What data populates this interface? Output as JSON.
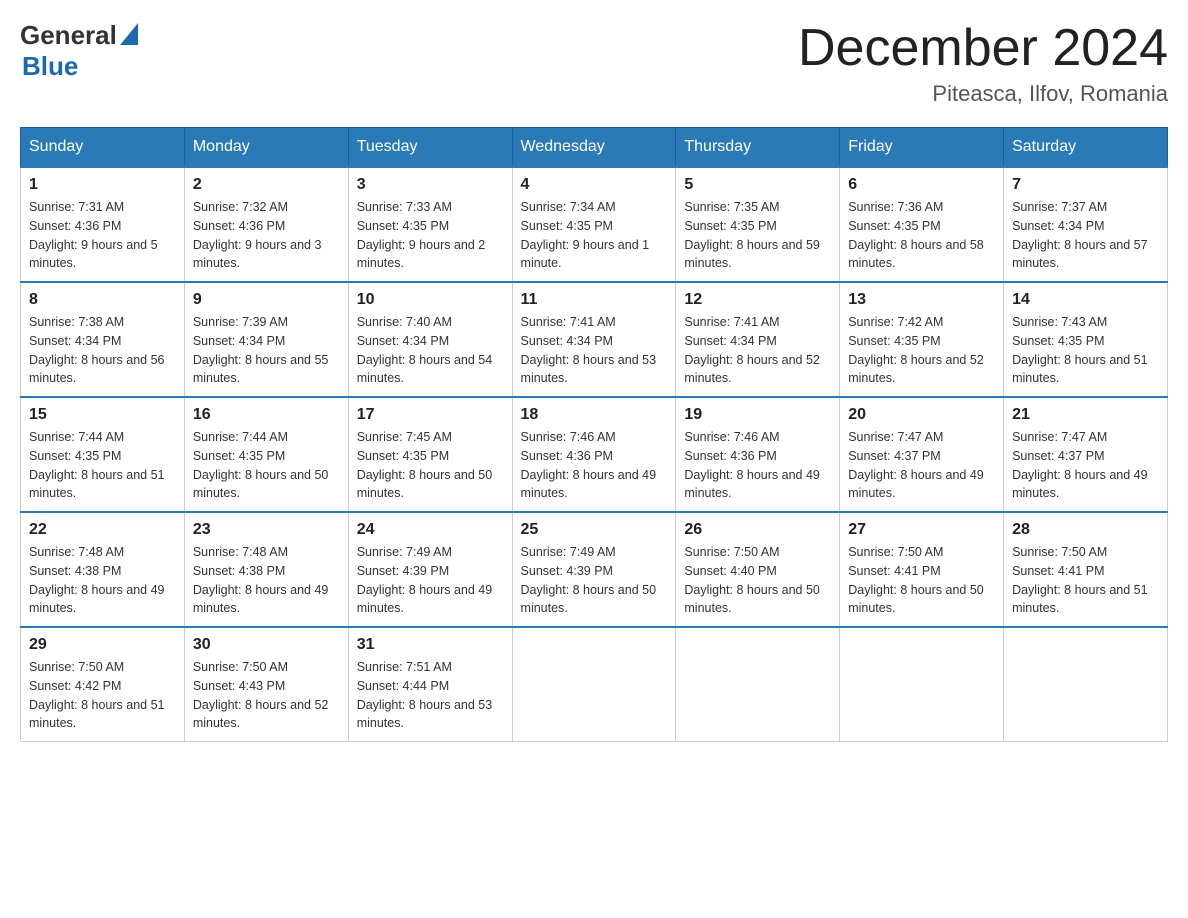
{
  "header": {
    "logo_general": "General",
    "logo_blue": "Blue",
    "title": "December 2024",
    "subtitle": "Piteasca, Ilfov, Romania"
  },
  "days_of_week": [
    "Sunday",
    "Monday",
    "Tuesday",
    "Wednesday",
    "Thursday",
    "Friday",
    "Saturday"
  ],
  "weeks": [
    [
      {
        "day": "1",
        "sunrise": "7:31 AM",
        "sunset": "4:36 PM",
        "daylight": "9 hours and 5 minutes."
      },
      {
        "day": "2",
        "sunrise": "7:32 AM",
        "sunset": "4:36 PM",
        "daylight": "9 hours and 3 minutes."
      },
      {
        "day": "3",
        "sunrise": "7:33 AM",
        "sunset": "4:35 PM",
        "daylight": "9 hours and 2 minutes."
      },
      {
        "day": "4",
        "sunrise": "7:34 AM",
        "sunset": "4:35 PM",
        "daylight": "9 hours and 1 minute."
      },
      {
        "day": "5",
        "sunrise": "7:35 AM",
        "sunset": "4:35 PM",
        "daylight": "8 hours and 59 minutes."
      },
      {
        "day": "6",
        "sunrise": "7:36 AM",
        "sunset": "4:35 PM",
        "daylight": "8 hours and 58 minutes."
      },
      {
        "day": "7",
        "sunrise": "7:37 AM",
        "sunset": "4:34 PM",
        "daylight": "8 hours and 57 minutes."
      }
    ],
    [
      {
        "day": "8",
        "sunrise": "7:38 AM",
        "sunset": "4:34 PM",
        "daylight": "8 hours and 56 minutes."
      },
      {
        "day": "9",
        "sunrise": "7:39 AM",
        "sunset": "4:34 PM",
        "daylight": "8 hours and 55 minutes."
      },
      {
        "day": "10",
        "sunrise": "7:40 AM",
        "sunset": "4:34 PM",
        "daylight": "8 hours and 54 minutes."
      },
      {
        "day": "11",
        "sunrise": "7:41 AM",
        "sunset": "4:34 PM",
        "daylight": "8 hours and 53 minutes."
      },
      {
        "day": "12",
        "sunrise": "7:41 AM",
        "sunset": "4:34 PM",
        "daylight": "8 hours and 52 minutes."
      },
      {
        "day": "13",
        "sunrise": "7:42 AM",
        "sunset": "4:35 PM",
        "daylight": "8 hours and 52 minutes."
      },
      {
        "day": "14",
        "sunrise": "7:43 AM",
        "sunset": "4:35 PM",
        "daylight": "8 hours and 51 minutes."
      }
    ],
    [
      {
        "day": "15",
        "sunrise": "7:44 AM",
        "sunset": "4:35 PM",
        "daylight": "8 hours and 51 minutes."
      },
      {
        "day": "16",
        "sunrise": "7:44 AM",
        "sunset": "4:35 PM",
        "daylight": "8 hours and 50 minutes."
      },
      {
        "day": "17",
        "sunrise": "7:45 AM",
        "sunset": "4:35 PM",
        "daylight": "8 hours and 50 minutes."
      },
      {
        "day": "18",
        "sunrise": "7:46 AM",
        "sunset": "4:36 PM",
        "daylight": "8 hours and 49 minutes."
      },
      {
        "day": "19",
        "sunrise": "7:46 AM",
        "sunset": "4:36 PM",
        "daylight": "8 hours and 49 minutes."
      },
      {
        "day": "20",
        "sunrise": "7:47 AM",
        "sunset": "4:37 PM",
        "daylight": "8 hours and 49 minutes."
      },
      {
        "day": "21",
        "sunrise": "7:47 AM",
        "sunset": "4:37 PM",
        "daylight": "8 hours and 49 minutes."
      }
    ],
    [
      {
        "day": "22",
        "sunrise": "7:48 AM",
        "sunset": "4:38 PM",
        "daylight": "8 hours and 49 minutes."
      },
      {
        "day": "23",
        "sunrise": "7:48 AM",
        "sunset": "4:38 PM",
        "daylight": "8 hours and 49 minutes."
      },
      {
        "day": "24",
        "sunrise": "7:49 AM",
        "sunset": "4:39 PM",
        "daylight": "8 hours and 49 minutes."
      },
      {
        "day": "25",
        "sunrise": "7:49 AM",
        "sunset": "4:39 PM",
        "daylight": "8 hours and 50 minutes."
      },
      {
        "day": "26",
        "sunrise": "7:50 AM",
        "sunset": "4:40 PM",
        "daylight": "8 hours and 50 minutes."
      },
      {
        "day": "27",
        "sunrise": "7:50 AM",
        "sunset": "4:41 PM",
        "daylight": "8 hours and 50 minutes."
      },
      {
        "day": "28",
        "sunrise": "7:50 AM",
        "sunset": "4:41 PM",
        "daylight": "8 hours and 51 minutes."
      }
    ],
    [
      {
        "day": "29",
        "sunrise": "7:50 AM",
        "sunset": "4:42 PM",
        "daylight": "8 hours and 51 minutes."
      },
      {
        "day": "30",
        "sunrise": "7:50 AM",
        "sunset": "4:43 PM",
        "daylight": "8 hours and 52 minutes."
      },
      {
        "day": "31",
        "sunrise": "7:51 AM",
        "sunset": "4:44 PM",
        "daylight": "8 hours and 53 minutes."
      },
      null,
      null,
      null,
      null
    ]
  ]
}
